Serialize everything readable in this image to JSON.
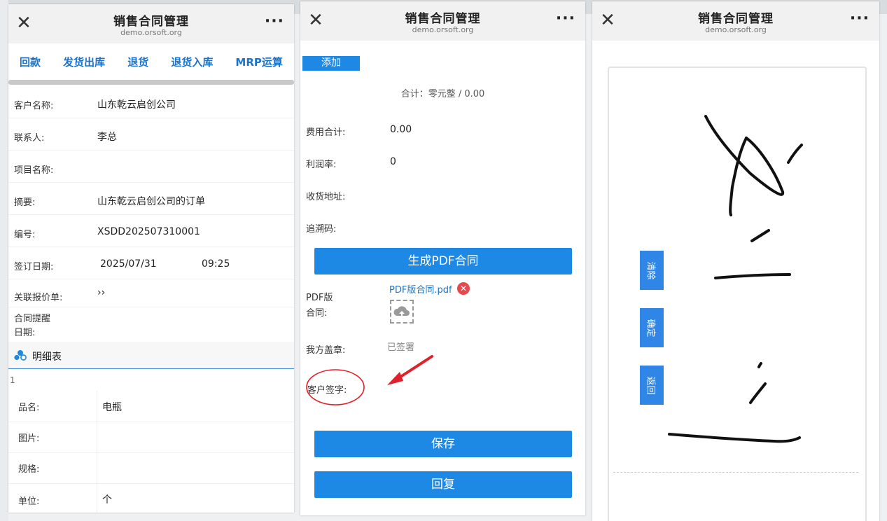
{
  "app": {
    "title": "销售合同管理",
    "domain": "demo.orsoft.org",
    "more_label": "···",
    "close_label": "✕"
  },
  "panel1": {
    "tabs": [
      "回款",
      "发货出库",
      "退货",
      "退货入库",
      "MRP运算"
    ],
    "fields": [
      {
        "label": "客户名称:",
        "value": "山东乾云启创公司"
      },
      {
        "label": "联系人:",
        "value": "李总"
      },
      {
        "label": "项目名称:",
        "value": ""
      },
      {
        "label": "摘要:",
        "value": "山东乾云启创公司的订单"
      },
      {
        "label": "编号:",
        "value": "XSDD202507310001"
      },
      {
        "label": "签订日期:",
        "value": "2025/07/31"
      },
      {
        "label": "关联报价单:",
        "value": "››"
      }
    ],
    "sign_time": "09:25",
    "reminder_label_1": "合同提醒",
    "reminder_label_2": "日期:",
    "section_title": "明细表",
    "item_index": "1",
    "detail_fields": [
      {
        "label": "品名:",
        "value": "电瓶"
      },
      {
        "label": "图片:",
        "value": ""
      },
      {
        "label": "规格:",
        "value": ""
      },
      {
        "label": "单位:",
        "value": "个"
      }
    ]
  },
  "panel2": {
    "add_label": "添加",
    "total_label": "合计：零元整 / 0.00",
    "fields": [
      {
        "label": "费用合计:",
        "value": "0.00"
      },
      {
        "label": "利润率:",
        "value": "0"
      },
      {
        "label": "收货地址:",
        "value": ""
      },
      {
        "label": "追溯码:",
        "value": ""
      }
    ],
    "generate_pdf_label": "生成PDF合同",
    "pdf_label_1": "PDF版",
    "pdf_label_2": "合同:",
    "pdf_file": "PDF版合同.pdf",
    "our_seal_label": "我方盖章:",
    "our_seal_value": "已签署",
    "customer_sign_label": "客户签字:",
    "save_label": "保存",
    "reply_label": "回复",
    "annotation_color": "#e0202a"
  },
  "panel3": {
    "buttons": [
      "清除",
      "确定",
      "返回"
    ]
  },
  "colors": {
    "accent": "#1e88e5",
    "link": "#1a73c8",
    "delete": "#e5484d"
  }
}
